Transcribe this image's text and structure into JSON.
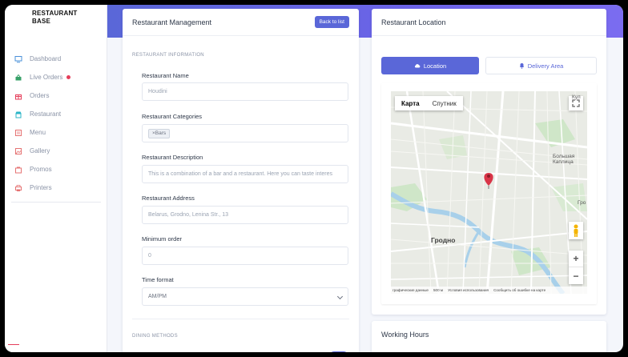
{
  "brand": {
    "line1": "RESTAURANT",
    "line2": "BASE"
  },
  "sidebar": {
    "items": [
      {
        "label": "Dashboard",
        "icon": "monitor-icon",
        "color": "#4a90d9"
      },
      {
        "label": "Live Orders",
        "icon": "basket-icon",
        "color": "#38a169",
        "badge_color": "#e53e5a"
      },
      {
        "label": "Orders",
        "icon": "gift-icon",
        "color": "#e53e5a"
      },
      {
        "label": "Restaurant",
        "icon": "store-icon",
        "color": "#2bb5c7"
      },
      {
        "label": "Menu",
        "icon": "menu-icon",
        "color": "#e57373"
      },
      {
        "label": "Gallery",
        "icon": "image-icon",
        "color": "#e57373"
      },
      {
        "label": "Promos",
        "icon": "tag-icon",
        "color": "#e57373"
      },
      {
        "label": "Printers",
        "icon": "printer-icon",
        "color": "#e57373"
      }
    ]
  },
  "management": {
    "title": "Restaurant Management",
    "back_label": "Back to list",
    "section_info": "RESTAURANT INFORMATION",
    "fields": {
      "name": {
        "label": "Restaurant Name",
        "value": "Houdini"
      },
      "categories": {
        "label": "Restaurant Categories",
        "tag": "Bars",
        "tag_remove": "×"
      },
      "description": {
        "label": "Restaurant Description",
        "value": "This is a combination of a bar and a restaurant. Here you can taste interes"
      },
      "address": {
        "label": "Restaurant Address",
        "value": "Belarus, Grodno, Lenina Str., 13"
      },
      "min_order": {
        "label": "Minimum order",
        "value": "0"
      },
      "time_format": {
        "label": "Time format",
        "value": "AM/PM"
      }
    },
    "section_dining": "DINING METHODS"
  },
  "location": {
    "title": "Restaurant Location",
    "tab_location": "Location",
    "tab_delivery": "Delivery Area",
    "map": {
      "type_map": "Карта",
      "type_satellite": "Спутник",
      "city": "Гродно",
      "footer_data": "графические данные",
      "footer_scale": "500 м",
      "footer_terms": "Условия использования",
      "footer_report": "Сообщить об ошибке на карте",
      "zoom_in": "+",
      "zoom_out": "−",
      "label_top_right": "Кул",
      "label_big": "Большая",
      "label_big2": "Каплица",
      "label_gr": "Гро"
    }
  },
  "hours": {
    "title": "Working Hours"
  }
}
